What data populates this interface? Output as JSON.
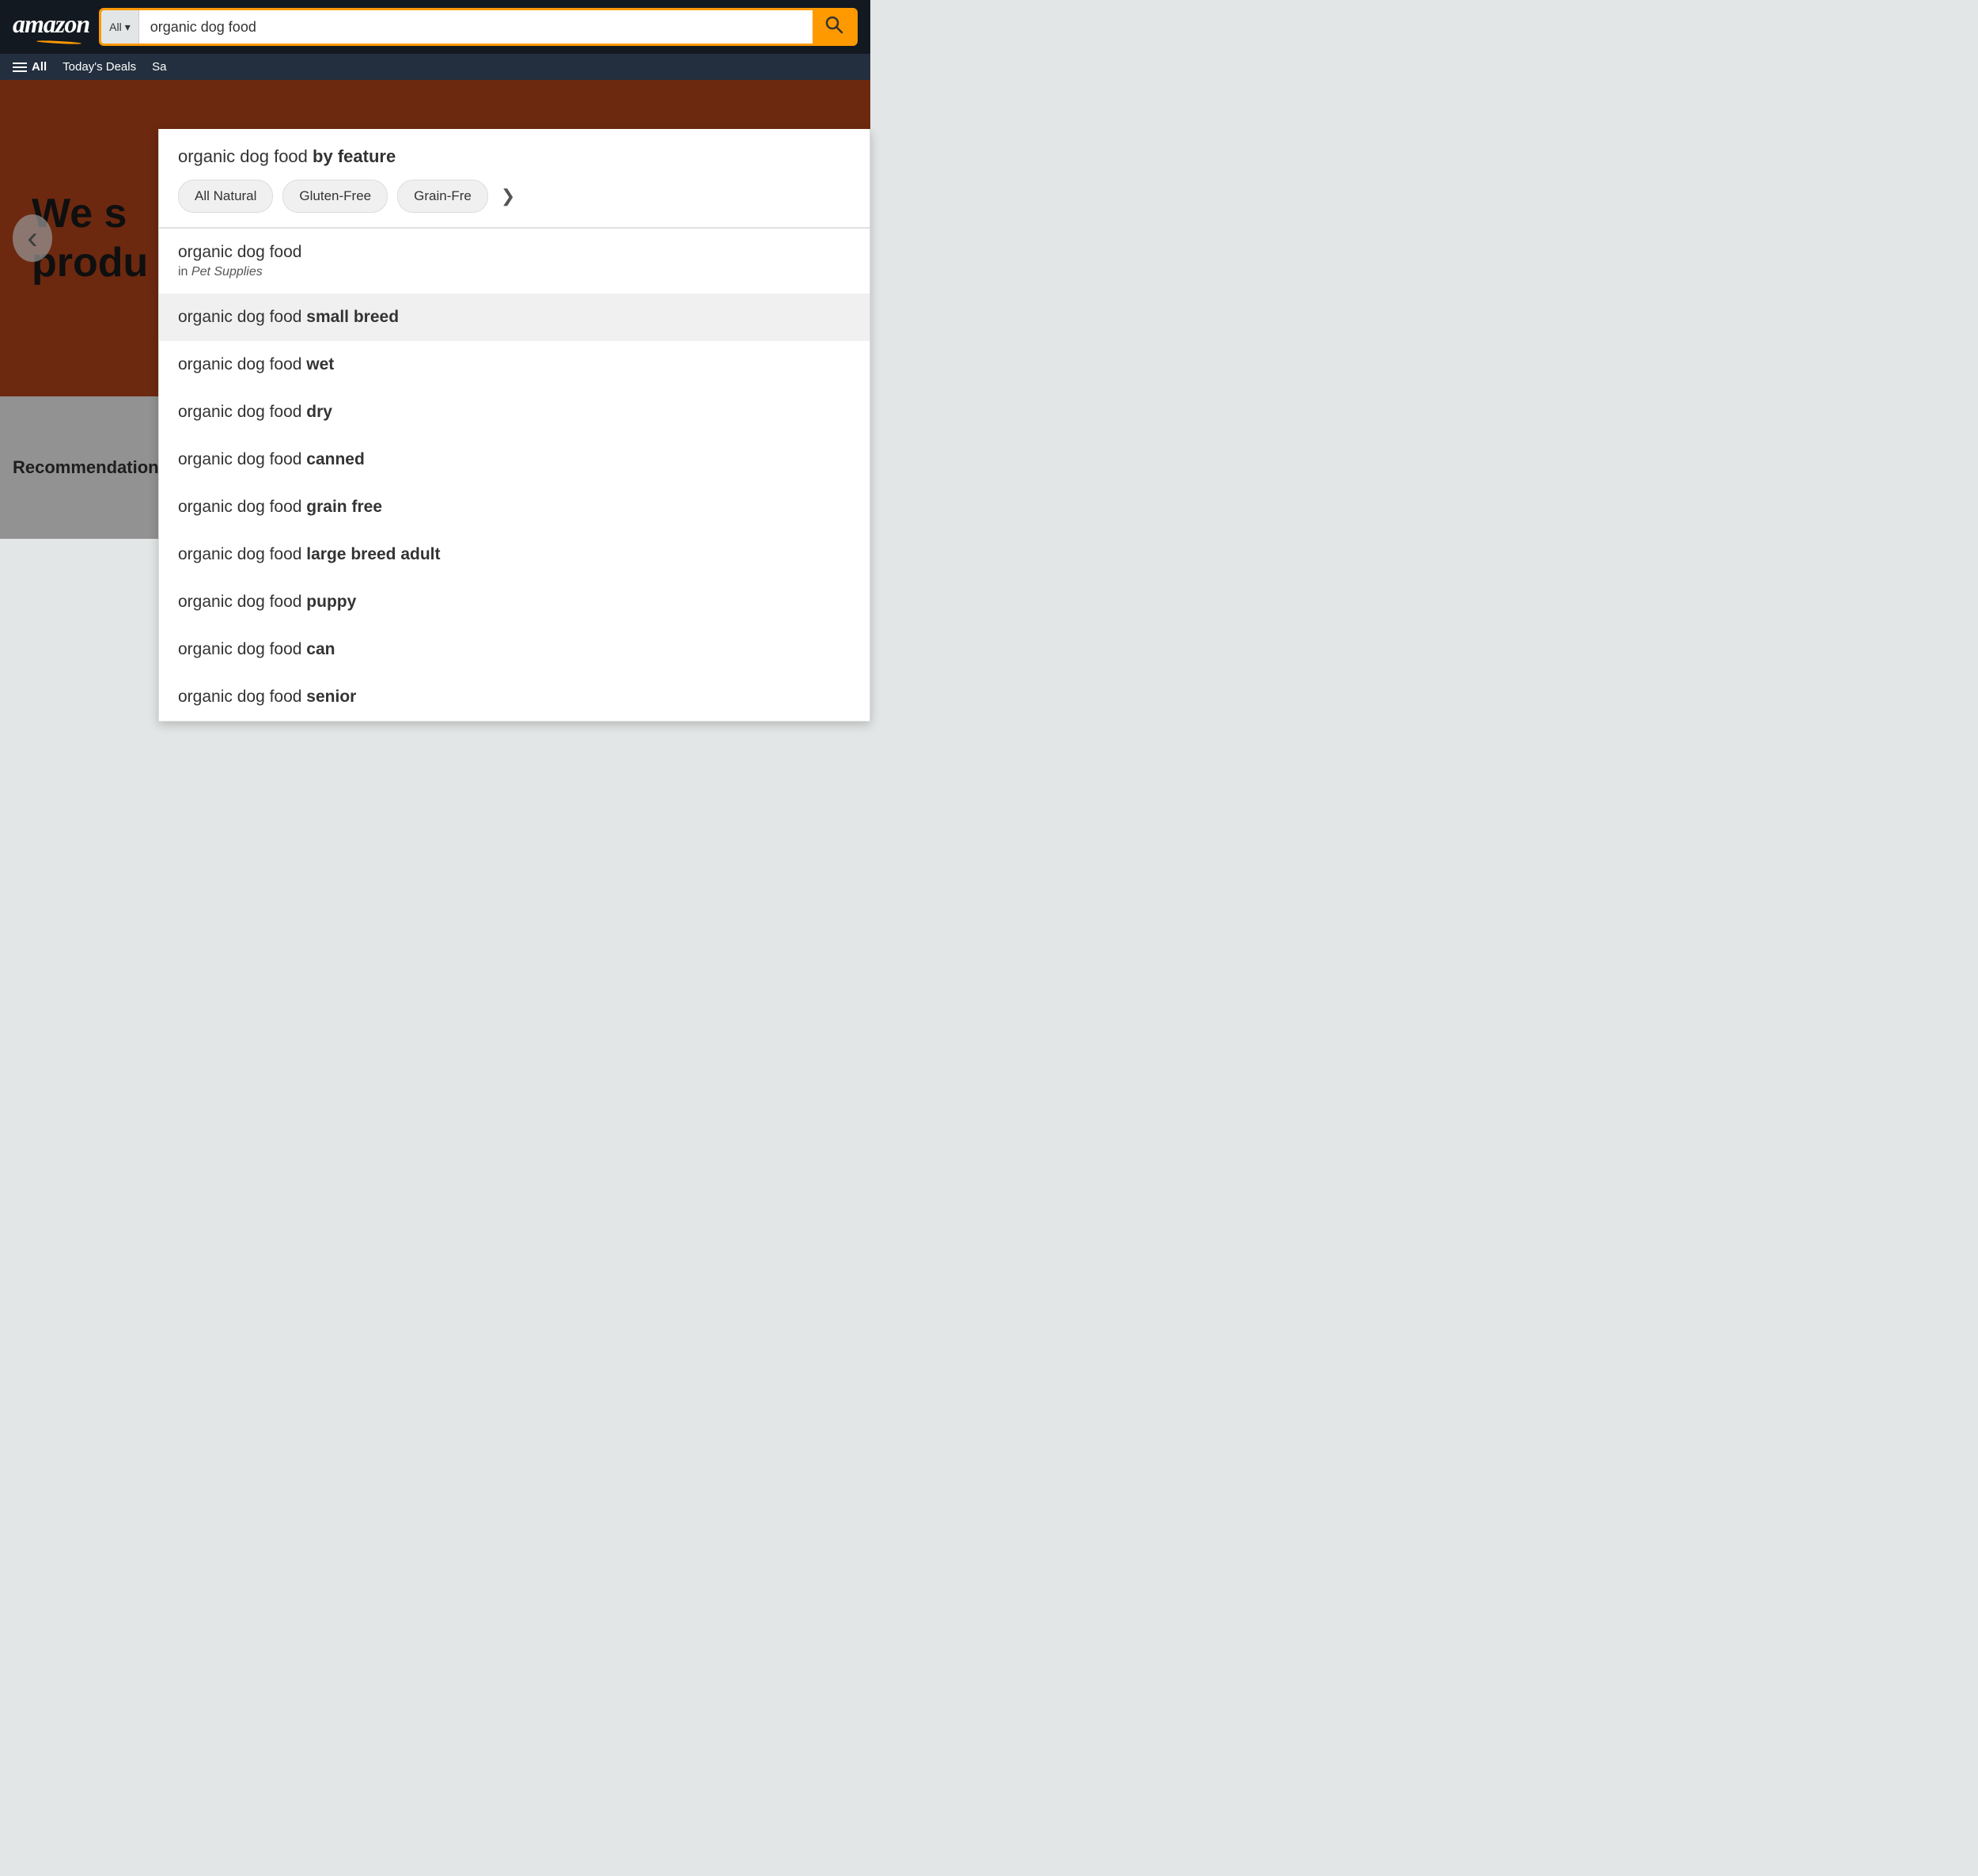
{
  "header": {
    "logo": "amazon",
    "search": {
      "category_label": "All",
      "category_arrow": "▾",
      "input_value": "organic dog food",
      "search_button_icon": "🔍"
    }
  },
  "nav": {
    "all_label": "All",
    "links": [
      "Today's Deals",
      "Sa"
    ]
  },
  "dropdown": {
    "feature_heading_plain": "organic dog food ",
    "feature_heading_bold": "by feature",
    "tags": [
      "All Natural",
      "Gluten-Free",
      "Grain-Fre"
    ],
    "tag_more_arrow": "❯",
    "suggestions": [
      {
        "plain": "organic dog food",
        "bold": "",
        "sub_in": "in",
        "sub_category": "Pet Supplies",
        "highlighted": false
      },
      {
        "plain": "organic dog food ",
        "bold": "small breed",
        "sub_in": "",
        "sub_category": "",
        "highlighted": true
      },
      {
        "plain": "organic dog food ",
        "bold": "wet",
        "sub_in": "",
        "sub_category": "",
        "highlighted": false
      },
      {
        "plain": "organic dog food ",
        "bold": "dry",
        "sub_in": "",
        "sub_category": "",
        "highlighted": false
      },
      {
        "plain": "organic dog food ",
        "bold": "canned",
        "sub_in": "",
        "sub_category": "",
        "highlighted": false
      },
      {
        "plain": "organic dog food ",
        "bold": "grain free",
        "sub_in": "",
        "sub_category": "",
        "highlighted": false
      },
      {
        "plain": "organic dog food ",
        "bold": "large breed adult",
        "sub_in": "",
        "sub_category": "",
        "highlighted": false
      },
      {
        "plain": "organic dog food ",
        "bold": "puppy",
        "sub_in": "",
        "sub_category": "",
        "highlighted": false
      },
      {
        "plain": "organic dog food ",
        "bold": "can",
        "sub_in": "",
        "sub_category": "",
        "highlighted": false
      },
      {
        "plain": "organic dog food ",
        "bold": "senior",
        "sub_in": "",
        "sub_category": "",
        "highlighted": false
      }
    ]
  },
  "hero": {
    "text_line1": "We s",
    "text_line2": "produ",
    "nav_left": "‹"
  },
  "recs": {
    "label": "Recommendations for yo"
  }
}
